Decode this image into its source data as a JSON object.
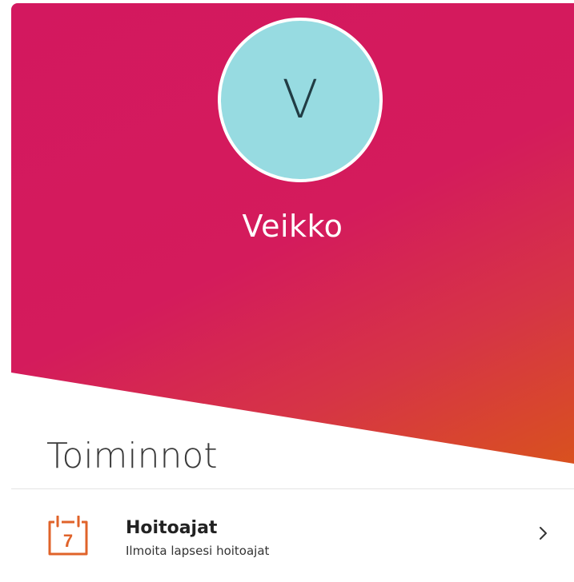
{
  "colors": {
    "hero_start": "#d3185f",
    "hero_end": "#d9531c",
    "avatar_bg": "#97dbe1",
    "icon_accent": "#e0632a"
  },
  "profile": {
    "avatar_initial": "V",
    "name": "Veikko"
  },
  "section": {
    "title": "Toiminnot"
  },
  "actions": [
    {
      "icon": "calendar-icon",
      "icon_number": "7",
      "title": "Hoitoajat",
      "subtitle": "Ilmoita lapsesi hoitoajat",
      "chevron": "chevron-right-icon"
    }
  ]
}
